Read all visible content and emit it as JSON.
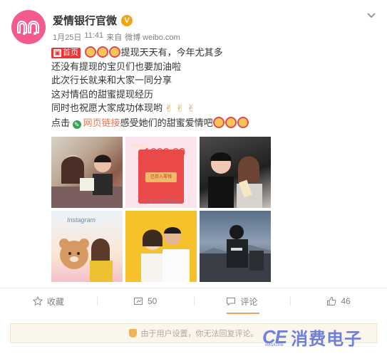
{
  "account": {
    "name": "爱情银行官微",
    "verified_badge": "V",
    "date": "1月25日",
    "time": "11:41",
    "source_prefix": "来自",
    "source": "微博 weibo.com"
  },
  "post": {
    "home_tag": "首页",
    "line1": "提现天天有，今年尤其多",
    "line2": "还没有提现的宝贝们也要加油啦",
    "line3": "此次行长就来和大家一同分享",
    "line4": "这对情侣的甜蜜提现经历",
    "line5": "同时也祝愿大家成功体现哟",
    "line6_prefix": "点击",
    "link_label": "网页链接",
    "line6_suffix": "感受她们的甜蜜爱情吧"
  },
  "photos": {
    "red_packet_heading": "真爱无价",
    "red_packet_amount": "1000.00",
    "red_packet_button": "已存入零钱",
    "red_packet_note": "— 乔家宝贝爱情成长 —",
    "instagram_text": "Instagram"
  },
  "actions": {
    "favorite_label": "收藏",
    "repost_count": "50",
    "comment_label": "评论",
    "like_count": "46"
  },
  "notice": {
    "text": "由于用户设置，你无法回复评论。"
  },
  "watermark": {
    "brand": "CE",
    "sub": "MAGAZINE",
    "text": "消费电子"
  },
  "colors": {
    "accent_orange": "#eb7350",
    "verified": "#f2a313",
    "avatar_pink": "#f35a8e",
    "watermark_blue": "#6e7fdc"
  }
}
